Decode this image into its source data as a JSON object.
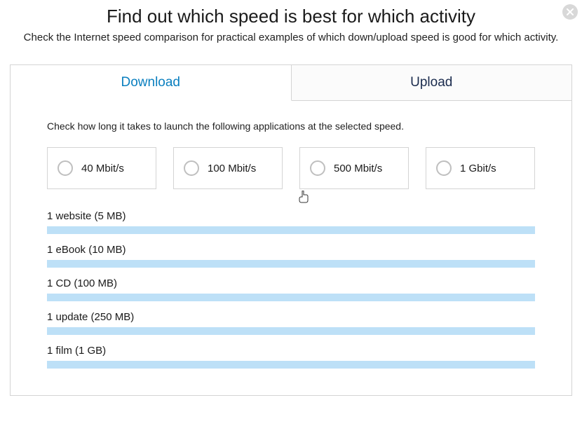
{
  "header": {
    "title": "Find out which speed is best for which activity",
    "subtitle": "Check the Internet speed comparison for practical examples of which down/upload speed is good for which activity."
  },
  "tabs": {
    "download": "Download",
    "upload": "Upload"
  },
  "content": {
    "instruction": "Check how long it takes to launch the following applications at the selected speed.",
    "speeds": [
      "40 Mbit/s",
      "100 Mbit/s",
      "500 Mbit/s",
      "1 Gbit/s"
    ],
    "activities": [
      "1 website (5 MB)",
      "1 eBook (10 MB)",
      "1 CD (100 MB)",
      "1 update (250 MB)",
      "1 film (1 GB)"
    ]
  }
}
